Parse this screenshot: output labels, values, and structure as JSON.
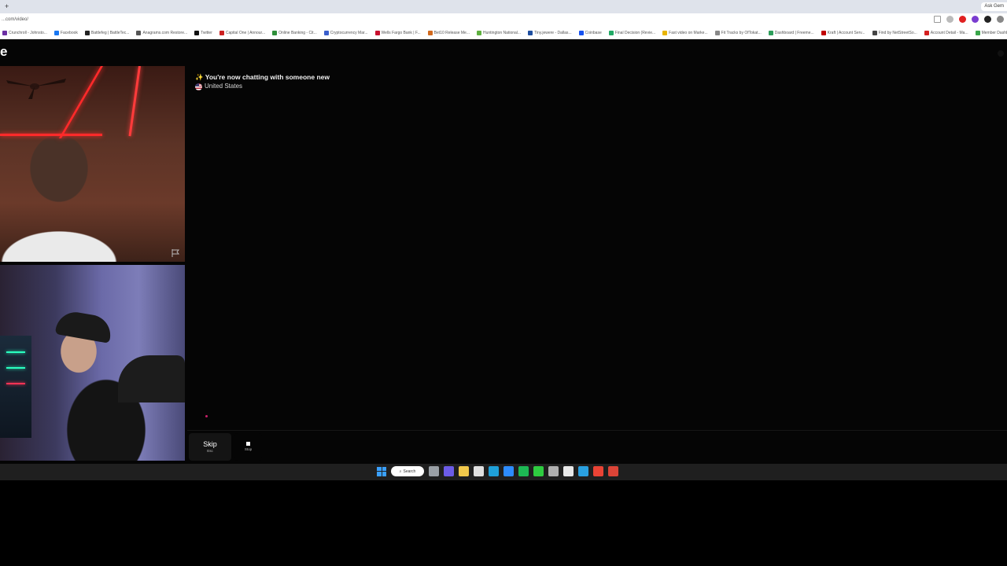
{
  "browser": {
    "new_tab": "+",
    "ask_button": "Ask Gem",
    "url": "...com/video/",
    "bookmarks": [
      {
        "label": "Crunchroll - Johnsto...",
        "color": "#6b2fa3"
      },
      {
        "label": "Facebook",
        "color": "#1877f2"
      },
      {
        "label": "Battlefeg | BattleTec...",
        "color": "#222222"
      },
      {
        "label": "Anagrams.com Restore...",
        "color": "#555555"
      },
      {
        "label": "Twitter",
        "color": "#111111"
      },
      {
        "label": "Capital One | Annour...",
        "color": "#cc2222"
      },
      {
        "label": "Online Banking - Cit...",
        "color": "#2f8f3a"
      },
      {
        "label": "Cryptocurrency Mar...",
        "color": "#3a5fcd"
      },
      {
        "label": "Wells Fargo Bank | F...",
        "color": "#c8102e"
      },
      {
        "label": "Bet10 Release Me...",
        "color": "#d26a1e"
      },
      {
        "label": "Huntington National...",
        "color": "#5fb040"
      },
      {
        "label": "Tiny.jewere - Dallas...",
        "color": "#1f4fa0"
      },
      {
        "label": "Coinbase",
        "color": "#1652f0"
      },
      {
        "label": "Final Decision (Revie...",
        "color": "#22aa66"
      },
      {
        "label": "Fast video on Marke...",
        "color": "#e8b400"
      },
      {
        "label": "Fit Tracks by OfTokat...",
        "color": "#888888"
      },
      {
        "label": "Dashboard | Freeme...",
        "color": "#2e9e5b"
      },
      {
        "label": "Kraft | Account Serv...",
        "color": "#c00000"
      },
      {
        "label": "Find by NetStreetSo...",
        "color": "#444444"
      },
      {
        "label": "Account Detail - Ma...",
        "color": "#d42020"
      },
      {
        "label": "Member Dashboard",
        "color": "#3aa64a"
      }
    ]
  },
  "page": {
    "logo": "e",
    "chat_header": {
      "status": "✨ You're now chatting with someone new",
      "country": "United States"
    },
    "controls": {
      "skip_label": "Skip",
      "skip_hint": "Esc",
      "stop_label": "Stop"
    }
  },
  "taskbar": {
    "search_label": "Search",
    "icons": [
      {
        "name": "task-view",
        "color": "#9aa0a6"
      },
      {
        "name": "copilot",
        "color": "#6c5ce7"
      },
      {
        "name": "file-explorer",
        "color": "#f2c94c"
      },
      {
        "name": "store",
        "color": "#e0e0e0"
      },
      {
        "name": "edge",
        "color": "#1fa0d8"
      },
      {
        "name": "twitch",
        "color": "#2d8cff"
      },
      {
        "name": "spotify",
        "color": "#1db954"
      },
      {
        "name": "sheets",
        "color": "#2ecc40"
      },
      {
        "name": "calculator",
        "color": "#b0b0b0"
      },
      {
        "name": "snipping",
        "color": "#e8e8e8"
      },
      {
        "name": "outlook",
        "color": "#2aa0e0"
      },
      {
        "name": "chrome",
        "color": "#ea4335"
      },
      {
        "name": "chrome-alt",
        "color": "#db4437"
      }
    ]
  }
}
